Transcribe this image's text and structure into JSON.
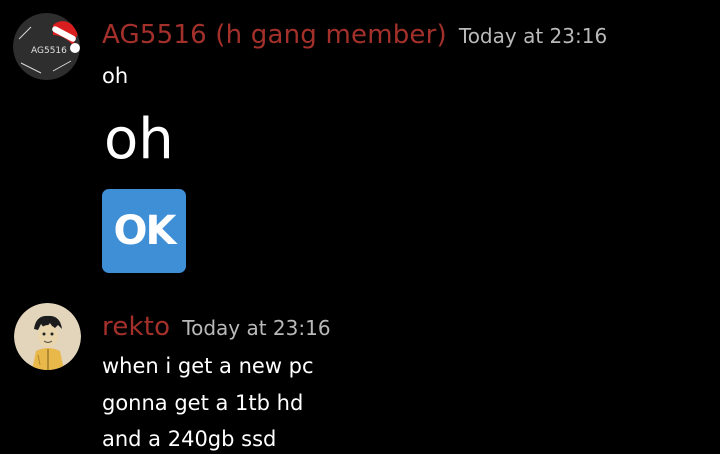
{
  "messages": [
    {
      "author": "AG5516 (h gang member)",
      "timestamp": "Today at 23:16",
      "avatar_text": "AG5516",
      "lines": [
        "oh"
      ],
      "big_text": "oh",
      "emoji_text": "OK",
      "emoji_name": "ok-button-emoji"
    },
    {
      "author": "rekto",
      "timestamp": "Today at 23:16",
      "lines": [
        "when i get a new pc",
        "gonna get a 1tb hd",
        "and a 240gb ssd"
      ]
    }
  ],
  "colors": {
    "background": "#000000",
    "username": "#a3302b",
    "timestamp": "#b9b9b9",
    "text": "#ffffff",
    "ok_emoji": "#3f8fd6"
  }
}
